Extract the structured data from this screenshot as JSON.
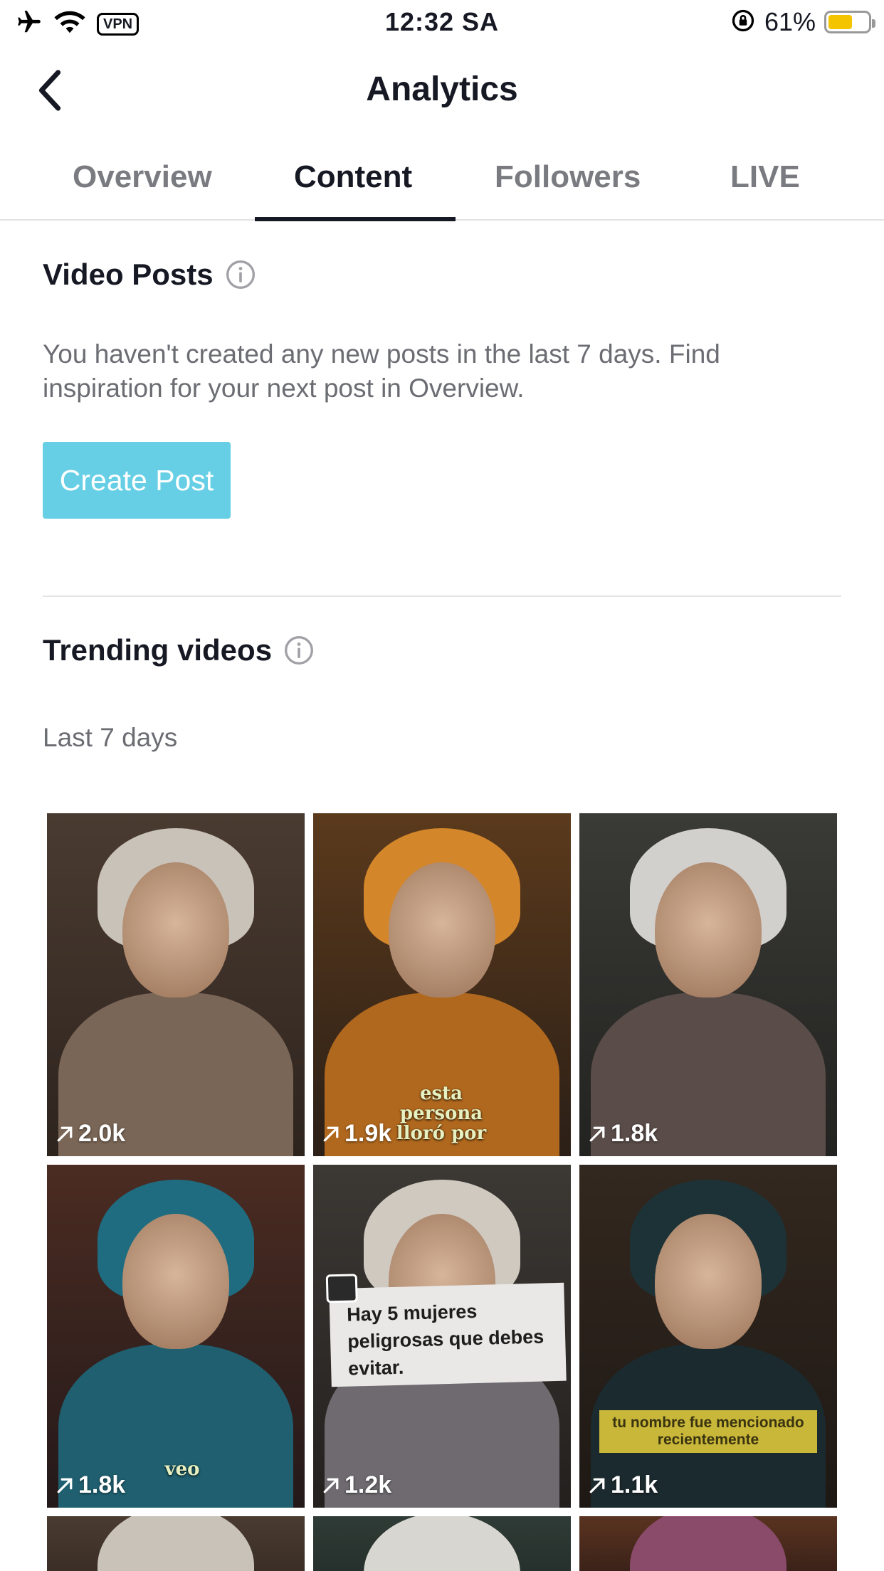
{
  "status_bar": {
    "time": "12:32 SA",
    "vpn": "VPN",
    "battery_percent": "61%",
    "battery_level": 0.61,
    "icons": [
      "airplane-icon",
      "wifi-icon",
      "vpn-icon",
      "rotation-lock-icon",
      "battery-icon"
    ]
  },
  "nav": {
    "title": "Analytics",
    "back_icon": "chevron-left-icon"
  },
  "tabs": [
    {
      "label": "Overview",
      "active": false
    },
    {
      "label": "Content",
      "active": true
    },
    {
      "label": "Followers",
      "active": false
    },
    {
      "label": "LIVE",
      "active": false
    }
  ],
  "video_posts": {
    "title": "Video Posts",
    "empty_message": "You haven't created any new posts in the last 7 days. Find inspiration for your next post in Overview.",
    "create_button": "Create Post",
    "accent_color": "#66cfe5"
  },
  "trending": {
    "title": "Trending videos",
    "period": "Last 7 days",
    "videos": [
      {
        "views": "2.0k"
      },
      {
        "views": "1.9k",
        "overlay_text": "esta persona lloró por"
      },
      {
        "views": "1.8k"
      },
      {
        "views": "1.8k",
        "overlay_text": "veo"
      },
      {
        "views": "1.2k",
        "overlay_text": "Hay 5 mujeres peligrosas que debes evitar."
      },
      {
        "views": "1.1k",
        "overlay_text": "tu nombre fue mencionado recientemente"
      }
    ]
  }
}
